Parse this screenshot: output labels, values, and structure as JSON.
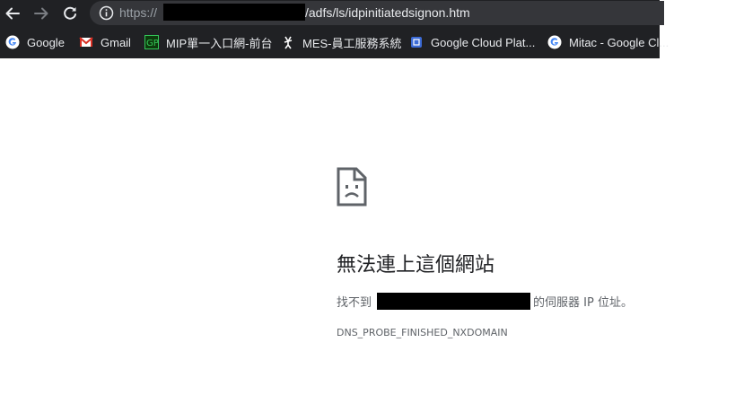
{
  "toolbar": {
    "back_icon": "arrow-left-icon",
    "forward_icon": "arrow-right-icon",
    "reload_icon": "reload-icon"
  },
  "omnibox": {
    "scheme": "https://",
    "path": "/adfs/ls/idpinitiatedsignon.htm",
    "info_icon": "info-icon"
  },
  "bookmarks": [
    {
      "label": "Google",
      "icon": "google-icon"
    },
    {
      "label": "Gmail",
      "icon": "gmail-icon"
    },
    {
      "label": "MIP單一入口網-前台",
      "icon": "mip-icon"
    },
    {
      "label": "MES-員工服務系統",
      "icon": "mes-icon"
    },
    {
      "label": "Google Cloud Plat...",
      "icon": "google-cloud-icon"
    },
    {
      "label": "Mitac - Google Cl...",
      "icon": "google-icon"
    }
  ],
  "error": {
    "icon": "sad-page-icon",
    "title": "無法連上這個網站",
    "msg_prefix": "找不到",
    "msg_suffix": "的伺服器 IP 位址。",
    "code": "DNS_PROBE_FINISHED_NXDOMAIN"
  },
  "colors": {
    "chrome_bg": "#202124",
    "omnibox_bg": "#35363a",
    "text_light": "#e8eaed",
    "text_muted": "#9aa0a6",
    "error_title": "#202124",
    "error_body": "#5f6368"
  }
}
